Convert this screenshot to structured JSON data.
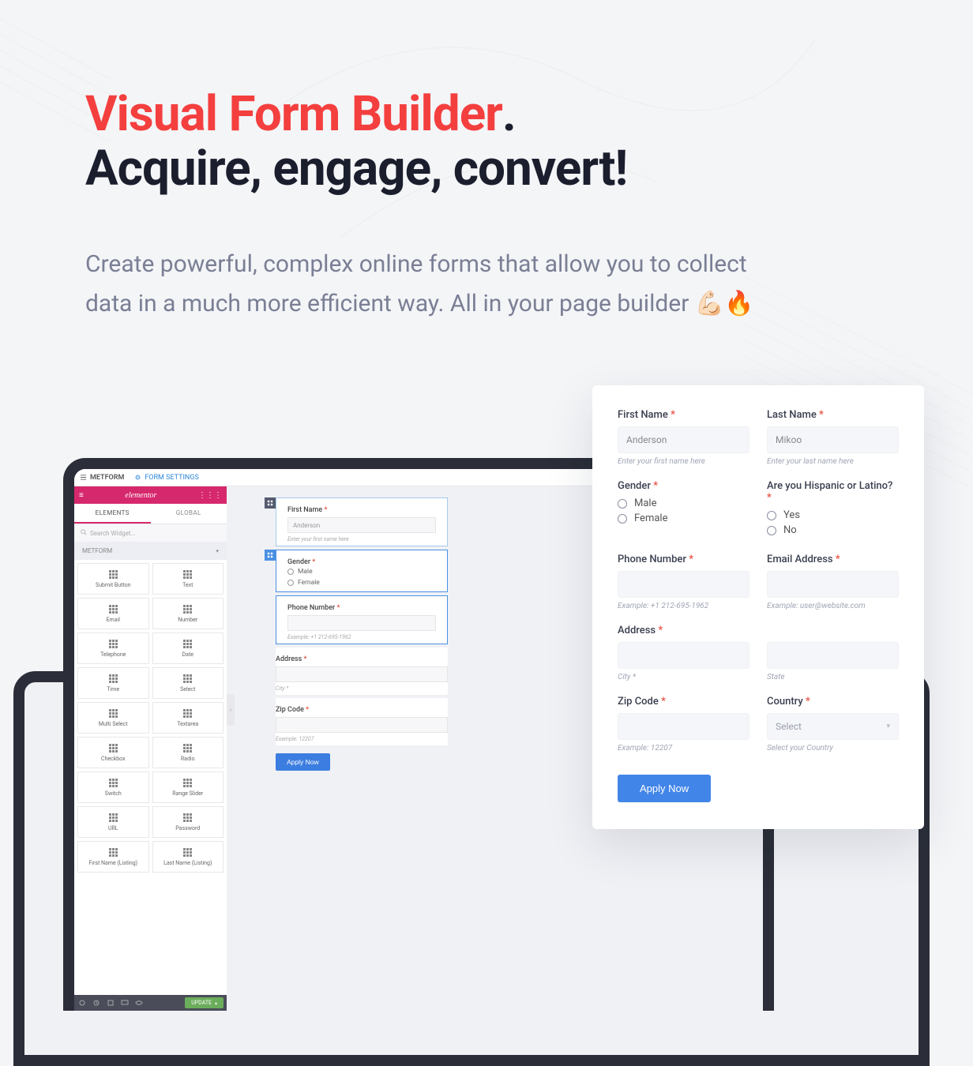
{
  "heading": {
    "red": "Visual Form Builder",
    "dot": ".",
    "dark": "Acquire, engage, convert!"
  },
  "subheading": "Create powerful, complex online forms that allow you to collect data in a much more efficient way. All in your page builder 💪🏻🔥",
  "editor": {
    "topbar": {
      "metform": "METFORM",
      "form_settings": "FORM SETTINGS"
    },
    "logo": "elementor",
    "tabs": {
      "elements": "ELEMENTS",
      "global": "GLOBAL"
    },
    "search_placeholder": "Search Widget...",
    "section": "METFORM",
    "widgets": [
      "Submit Button",
      "Text",
      "Email",
      "Number",
      "Telephone",
      "Date",
      "Time",
      "Select",
      "Multi Select",
      "Textarea",
      "Checkbox",
      "Radio",
      "Switch",
      "Range Slider",
      "URL",
      "Password",
      "First Name (Listing)",
      "Last Name (Listing)"
    ],
    "canvas": {
      "first_name": {
        "label": "First Name",
        "placeholder": "Anderson",
        "help": "Enter your first name here"
      },
      "gender": {
        "label": "Gender",
        "opts": [
          "Male",
          "Female"
        ]
      },
      "phone": {
        "label": "Phone Number",
        "help": "Example: +1 212-695-1962"
      },
      "address": {
        "label": "Address",
        "help": "City *"
      },
      "zip": {
        "label": "Zip Code",
        "help": "Example: 12207"
      },
      "apply": "Apply Now"
    },
    "footer": {
      "update": "UPDATE"
    }
  },
  "form": {
    "first_name": {
      "label": "First Name",
      "value": "Anderson",
      "help": "Enter your first name here"
    },
    "last_name": {
      "label": "Last Name",
      "value": "Mikoo",
      "help": "Enter your last name here"
    },
    "gender": {
      "label": "Gender",
      "opts": [
        "Male",
        "Female"
      ]
    },
    "hispanic": {
      "label": "Are you Hispanic or Latino?",
      "opts": [
        "Yes",
        "No"
      ]
    },
    "phone": {
      "label": "Phone Number",
      "help": "Example: +1 212-695-1962"
    },
    "email": {
      "label": "Email Address",
      "help": "Example: user@website.com"
    },
    "address": {
      "label": "Address",
      "city_help": "City *",
      "state_help": "State"
    },
    "zip": {
      "label": "Zip Code",
      "help": "Example: 12207"
    },
    "country": {
      "label": "Country",
      "placeholder": "Select",
      "help": "Select your Country"
    },
    "submit": "Apply Now"
  }
}
